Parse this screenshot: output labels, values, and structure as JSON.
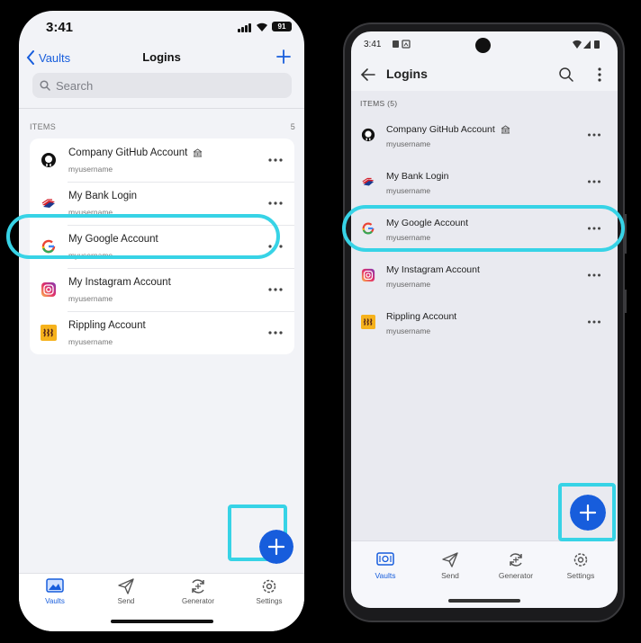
{
  "colors": {
    "accent": "#175ddc",
    "highlight": "#37d3e6",
    "background": "#f2f3f7"
  },
  "ios": {
    "status": {
      "time": "3:41",
      "battery": "91"
    },
    "nav": {
      "back_label": "Vaults",
      "title": "Logins"
    },
    "search": {
      "placeholder": "Search"
    },
    "section": {
      "label": "ITEMS",
      "count": "5"
    },
    "items": [
      {
        "name": "Company GitHub Account",
        "username": "myusername",
        "icon": "github-icon",
        "badge": "organization-icon"
      },
      {
        "name": "My Bank Login",
        "username": "myusername",
        "icon": "bank-logo-icon"
      },
      {
        "name": "My Google Account",
        "username": "myusername",
        "icon": "google-icon"
      },
      {
        "name": "My Instagram Account",
        "username": "myusername",
        "icon": "instagram-icon"
      },
      {
        "name": "Rippling Account",
        "username": "myusername",
        "icon": "rippling-icon"
      }
    ],
    "tabs": [
      {
        "label": "Vaults",
        "icon": "vault-icon",
        "active": true
      },
      {
        "label": "Send",
        "icon": "send-icon"
      },
      {
        "label": "Generator",
        "icon": "generator-icon"
      },
      {
        "label": "Settings",
        "icon": "gear-icon"
      }
    ]
  },
  "android": {
    "status": {
      "time": "3:41"
    },
    "nav": {
      "title": "Logins"
    },
    "section": {
      "label": "ITEMS (5)"
    },
    "items": [
      {
        "name": "Company GitHub Account",
        "username": "myusername",
        "icon": "github-icon",
        "badge": "organization-icon"
      },
      {
        "name": "My Bank Login",
        "username": "myusername",
        "icon": "bank-logo-icon"
      },
      {
        "name": "My Google Account",
        "username": "myusername",
        "icon": "google-icon"
      },
      {
        "name": "My Instagram Account",
        "username": "myusername",
        "icon": "instagram-icon"
      },
      {
        "name": "Rippling Account",
        "username": "myusername",
        "icon": "rippling-icon"
      }
    ],
    "tabs": [
      {
        "label": "Vaults",
        "icon": "vault-icon",
        "active": true
      },
      {
        "label": "Send",
        "icon": "send-icon"
      },
      {
        "label": "Generator",
        "icon": "generator-icon"
      },
      {
        "label": "Settings",
        "icon": "gear-icon"
      }
    ]
  }
}
